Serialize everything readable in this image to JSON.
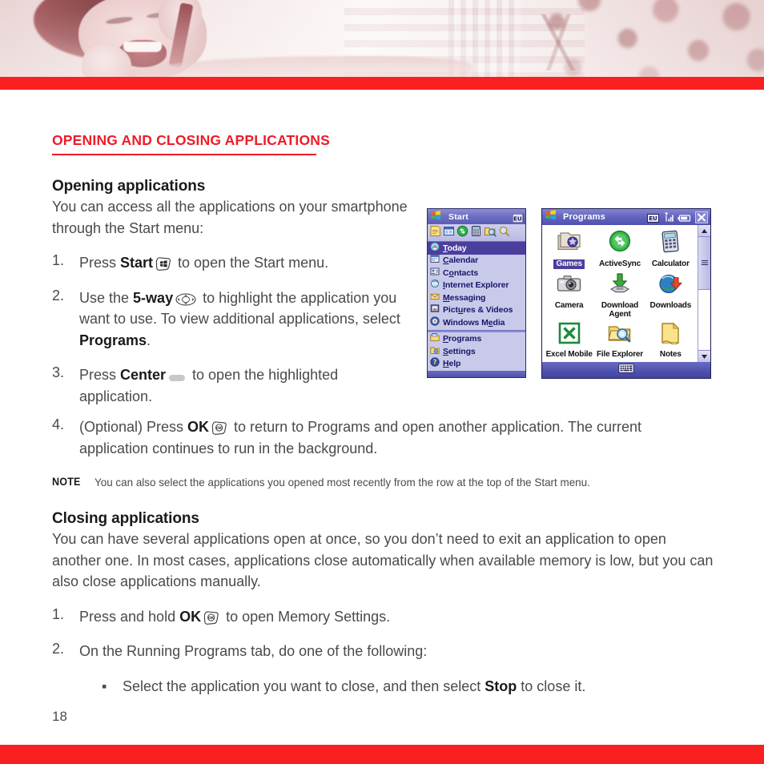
{
  "colors": {
    "accent_red": "#fa1f20",
    "heading_red": "#ed1c2a",
    "body_gray": "#4a4a4a",
    "wm_purple": "#4b3f9e",
    "wm_titlebar": "#6466bf"
  },
  "banner": {
    "alt": "laughing woman talking on a mobile phone, tinted red"
  },
  "section": {
    "heading": "OPENING AND CLOSING APPLICATIONS"
  },
  "opening": {
    "heading": "Opening applications",
    "intro": "You can access all the applications on your smartphone through the Start menu:",
    "steps": [
      {
        "num": "1.",
        "pre": "Press ",
        "bold": "Start",
        "icon": "start-key-icon",
        "post": " to open the Start menu."
      },
      {
        "num": "2.",
        "pre": "Use the ",
        "bold": "5-way",
        "icon": "five-way-nav-icon",
        "post": " to highlight the application you want to use. To view additional applications, select ",
        "bold2": "Programs",
        "post2": "."
      },
      {
        "num": "3.",
        "pre": "Press ",
        "bold": "Center",
        "icon": "center-key-icon",
        "post": " to open the highlighted application."
      },
      {
        "num": "4.",
        "pre": "(Optional) Press ",
        "bold": "OK",
        "icon": "ok-key-icon",
        "post": " to return to Programs and open another application. The current application continues to run in the background."
      }
    ],
    "note_label": "NOTE",
    "note_text": "You can also select the applications you opened most recently from the row at the top of the Start menu."
  },
  "closing": {
    "heading": "Closing applications",
    "intro": "You can have several applications open at once, so you don’t need to exit an application to open another one. In most cases, applications close automatically when available memory is low, but you can also close applications manually.",
    "steps": [
      {
        "num": "1.",
        "pre": "Press and hold ",
        "bold": "OK",
        "icon": "ok-key-icon",
        "post": " to open Memory Settings."
      },
      {
        "num": "2.",
        "pre": "On the Running Programs tab, do one of the following:",
        "bold": "",
        "icon": "",
        "post": ""
      }
    ],
    "bullets": [
      {
        "dot": "▪",
        "pre": "Select the application you want to close, and then select ",
        "bold": "Stop",
        "post": " to close it."
      }
    ]
  },
  "page_number": "18",
  "start_menu_screenshot": {
    "title": "Start",
    "region_badge": "EU",
    "recent_icons": [
      "notes-icon",
      "window-icon",
      "activesync-icon",
      "calculator-icon",
      "file-explorer-icon",
      "search-icon"
    ],
    "items": [
      {
        "label": "Today",
        "accel": "T",
        "icon": "today-icon",
        "selected": true
      },
      {
        "label": "Calendar",
        "accel": "C",
        "icon": "calendar-icon",
        "selected": false
      },
      {
        "label": "Contacts",
        "accel": "o",
        "icon": "contacts-icon",
        "selected": false
      },
      {
        "label": "Internet Explorer",
        "accel": "I",
        "icon": "internet-explorer-icon",
        "selected": false
      },
      {
        "label": "Messaging",
        "accel": "M",
        "icon": "messaging-icon",
        "selected": false
      },
      {
        "label": "Pictures & Videos",
        "accel": "u",
        "icon": "pictures-videos-icon",
        "selected": false
      },
      {
        "label": "Windows Media",
        "accel": "e",
        "icon": "windows-media-icon",
        "selected": false
      }
    ],
    "items_group2": [
      {
        "label": "Programs",
        "accel": "P",
        "icon": "programs-folder-icon",
        "selected": false
      },
      {
        "label": "Settings",
        "accel": "S",
        "icon": "settings-folder-icon",
        "selected": false
      },
      {
        "label": "Help",
        "accel": "H",
        "icon": "help-icon",
        "selected": false
      }
    ]
  },
  "programs_screenshot": {
    "title": "Programs",
    "region_badge": "EU",
    "titlebar_icons": [
      "signal-icon",
      "battery-icon",
      "close-icon"
    ],
    "apps": [
      {
        "label": "Games",
        "icon": "games-icon",
        "selected": true
      },
      {
        "label": "ActiveSync",
        "icon": "activesync-icon",
        "selected": false
      },
      {
        "label": "Calculator",
        "icon": "calculator-icon",
        "selected": false
      },
      {
        "label": "Camera",
        "icon": "camera-icon",
        "selected": false
      },
      {
        "label": "Download Agent",
        "icon": "download-agent-icon",
        "selected": false
      },
      {
        "label": "Downloads",
        "icon": "downloads-icon",
        "selected": false
      },
      {
        "label": "Excel Mobile",
        "icon": "excel-mobile-icon",
        "selected": false
      },
      {
        "label": "File Explorer",
        "icon": "file-explorer-icon",
        "selected": false
      },
      {
        "label": "Notes",
        "icon": "notes-icon",
        "selected": false
      }
    ],
    "soft_key": "keyboard-icon"
  }
}
